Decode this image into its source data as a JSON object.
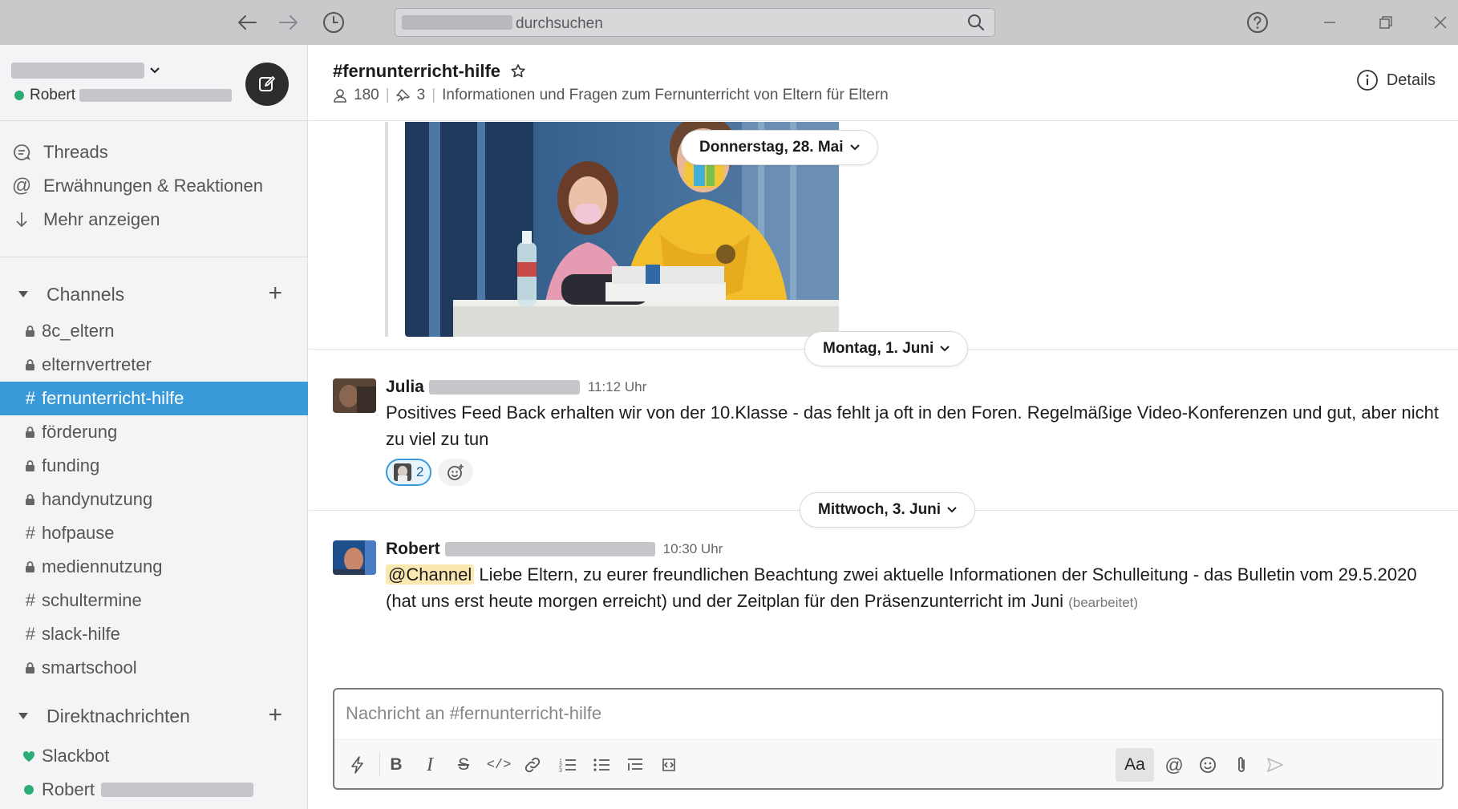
{
  "titlebar": {
    "search_placeholder": "durchsuchen",
    "icons": [
      "back-arrow",
      "forward-arrow",
      "history-clock",
      "search-magnifier",
      "help-circle",
      "minimize",
      "restore",
      "close"
    ]
  },
  "sidebar": {
    "user_name": "Robert",
    "nav": [
      {
        "label": "Threads",
        "icon": "threads-icon"
      },
      {
        "label": "Erwähnungen & Reaktionen",
        "icon": "at-icon"
      },
      {
        "label": "Mehr anzeigen",
        "icon": "arrow-down-icon"
      }
    ],
    "channels_label": "Channels",
    "channels": [
      {
        "name": "8c_eltern",
        "type": "private"
      },
      {
        "name": "elternvertreter",
        "type": "private"
      },
      {
        "name": "fernunterricht-hilfe",
        "type": "public",
        "active": true
      },
      {
        "name": "förderung",
        "type": "private"
      },
      {
        "name": "funding",
        "type": "private"
      },
      {
        "name": "handynutzung",
        "type": "private"
      },
      {
        "name": "hofpause",
        "type": "public"
      },
      {
        "name": "mediennutzung",
        "type": "private"
      },
      {
        "name": "schultermine",
        "type": "public"
      },
      {
        "name": "slack-hilfe",
        "type": "public"
      },
      {
        "name": "smartschool",
        "type": "private"
      }
    ],
    "dm_label": "Direktnachrichten",
    "dms": [
      {
        "name": "Slackbot",
        "status": "heart"
      },
      {
        "name": "Robert",
        "status": "online"
      }
    ],
    "accent": "#3a9ad9",
    "online_color": "#2bac76"
  },
  "header": {
    "title": "#fernunterricht-hilfe",
    "members": "180",
    "pins": "3",
    "topic": "Informationen und Fragen zum Fernunterricht von Eltern für Eltern",
    "details_label": "Details"
  },
  "feed": {
    "dates": [
      "Donnerstag, 28. Mai",
      "Montag, 1. Juni",
      "Mittwoch, 3. Juni"
    ],
    "messages": [
      {
        "author": "Julia",
        "time": "11:12 Uhr",
        "text": "Positives Feed Back erhalten wir von der 10.Klasse - das fehlt ja oft in den Foren. Regelmäßige Video-Konferenzen und gut, aber nicht zu viel zu tun",
        "reaction_count": "2"
      },
      {
        "author": "Robert",
        "time": "10:30 Uhr",
        "mention": "@Channel",
        "text": " Liebe Eltern, zu eurer freundlichen Beachtung zwei aktuelle Informationen der Schulleitung - das Bulletin vom 29.5.2020 (hat uns erst heute morgen erreicht) und der Zeitplan für den Präsenzunterricht im Juni",
        "edited": "(bearbeitet)"
      }
    ]
  },
  "composer": {
    "placeholder": "Nachricht an #fernunterricht-hilfe",
    "aa_label": "Aa"
  }
}
